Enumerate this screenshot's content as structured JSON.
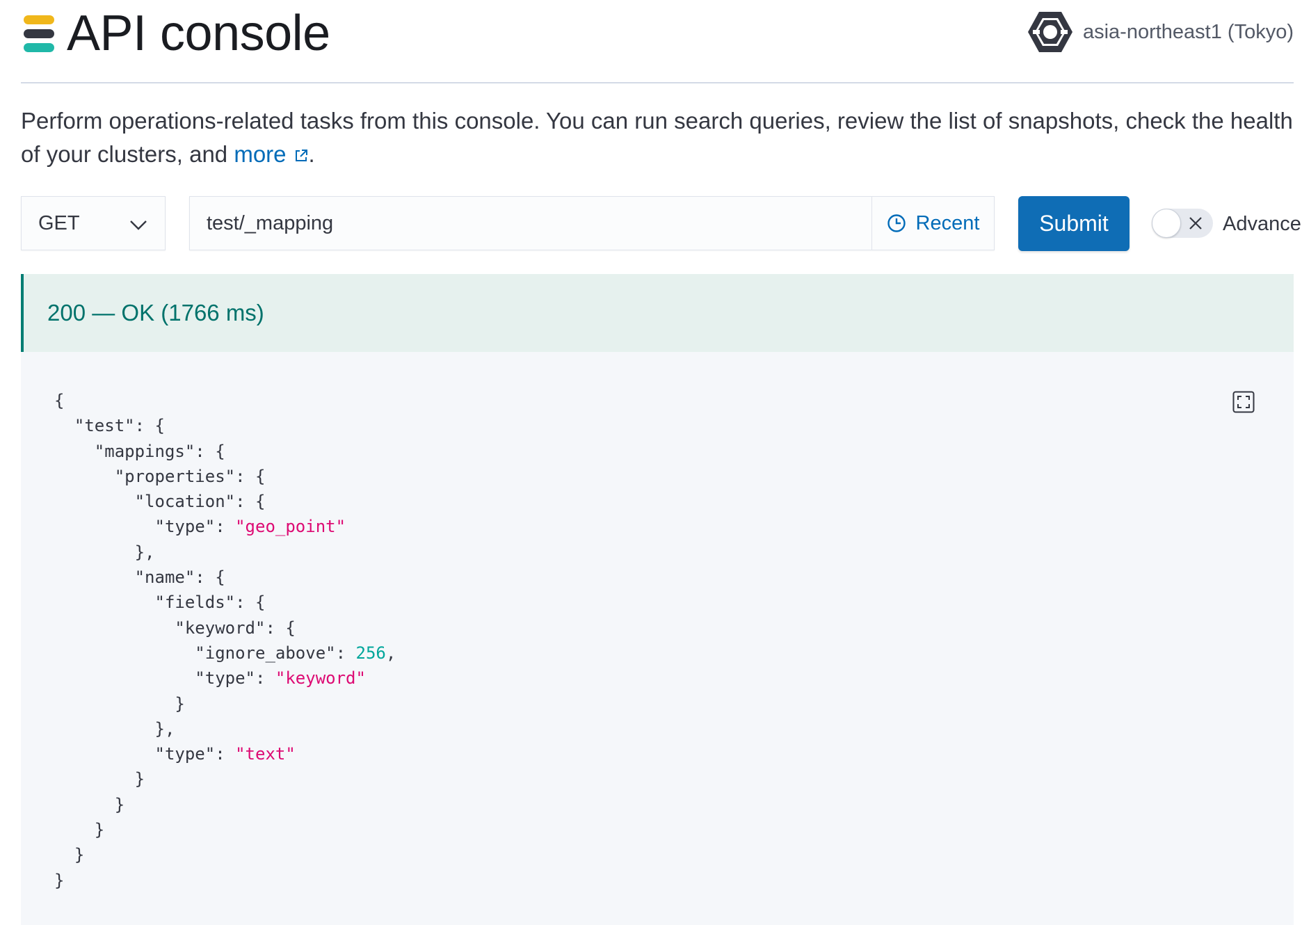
{
  "header": {
    "title": "API console",
    "logo_colors": [
      "#f0b71b",
      "#343741",
      "#20b8a8"
    ],
    "region_icon": "google-cloud-hexagon-icon",
    "region_label": "asia-northeast1 (Tokyo)"
  },
  "description": {
    "text": "Perform operations-related tasks from this console. You can run search queries, review the list of snapshots, check the health of your clusters, and ",
    "link_label": "more",
    "link_icon": "external-link-icon",
    "suffix": "."
  },
  "request": {
    "method": "GET",
    "method_icon": "chevron-down-icon",
    "path": "test/_mapping",
    "recent_label": "Recent",
    "recent_icon": "clock-icon",
    "submit_label": "Submit",
    "advanced_label": "Advanced",
    "advanced_enabled": false,
    "advanced_icon": "cross-icon"
  },
  "response": {
    "status_text": "200 — OK (1766 ms)",
    "status_color": "#017d73",
    "fullscreen_icon": "fullscreen-icon",
    "body_lines": [
      [
        {
          "t": "p",
          "v": "{"
        }
      ],
      [
        {
          "t": "p",
          "v": "  "
        },
        {
          "t": "k",
          "v": "\"test\""
        },
        {
          "t": "p",
          "v": ": {"
        }
      ],
      [
        {
          "t": "p",
          "v": "    "
        },
        {
          "t": "k",
          "v": "\"mappings\""
        },
        {
          "t": "p",
          "v": ": {"
        }
      ],
      [
        {
          "t": "p",
          "v": "      "
        },
        {
          "t": "k",
          "v": "\"properties\""
        },
        {
          "t": "p",
          "v": ": {"
        }
      ],
      [
        {
          "t": "p",
          "v": "        "
        },
        {
          "t": "k",
          "v": "\"location\""
        },
        {
          "t": "p",
          "v": ": {"
        }
      ],
      [
        {
          "t": "p",
          "v": "          "
        },
        {
          "t": "k",
          "v": "\"type\""
        },
        {
          "t": "p",
          "v": ": "
        },
        {
          "t": "s",
          "v": "\"geo_point\""
        }
      ],
      [
        {
          "t": "p",
          "v": "        },"
        }
      ],
      [
        {
          "t": "p",
          "v": "        "
        },
        {
          "t": "k",
          "v": "\"name\""
        },
        {
          "t": "p",
          "v": ": {"
        }
      ],
      [
        {
          "t": "p",
          "v": "          "
        },
        {
          "t": "k",
          "v": "\"fields\""
        },
        {
          "t": "p",
          "v": ": {"
        }
      ],
      [
        {
          "t": "p",
          "v": "            "
        },
        {
          "t": "k",
          "v": "\"keyword\""
        },
        {
          "t": "p",
          "v": ": {"
        }
      ],
      [
        {
          "t": "p",
          "v": "              "
        },
        {
          "t": "k",
          "v": "\"ignore_above\""
        },
        {
          "t": "p",
          "v": ": "
        },
        {
          "t": "n",
          "v": "256"
        },
        {
          "t": "p",
          "v": ","
        }
      ],
      [
        {
          "t": "p",
          "v": "              "
        },
        {
          "t": "k",
          "v": "\"type\""
        },
        {
          "t": "p",
          "v": ": "
        },
        {
          "t": "s",
          "v": "\"keyword\""
        }
      ],
      [
        {
          "t": "p",
          "v": "            }"
        }
      ],
      [
        {
          "t": "p",
          "v": "          },"
        }
      ],
      [
        {
          "t": "p",
          "v": "          "
        },
        {
          "t": "k",
          "v": "\"type\""
        },
        {
          "t": "p",
          "v": ": "
        },
        {
          "t": "s",
          "v": "\"text\""
        }
      ],
      [
        {
          "t": "p",
          "v": "        }"
        }
      ],
      [
        {
          "t": "p",
          "v": "      }"
        }
      ],
      [
        {
          "t": "p",
          "v": "    }"
        }
      ],
      [
        {
          "t": "p",
          "v": "  }"
        }
      ],
      [
        {
          "t": "p",
          "v": "}"
        }
      ]
    ]
  }
}
